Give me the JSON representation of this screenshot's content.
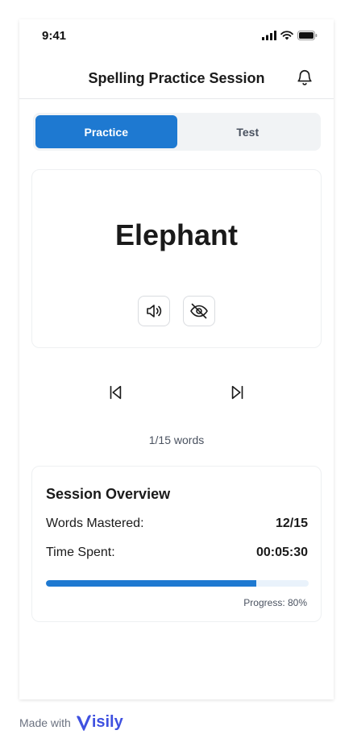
{
  "status_bar": {
    "time": "9:41"
  },
  "header": {
    "title": "Spelling Practice Session"
  },
  "tabs": [
    {
      "label": "Practice",
      "active": true
    },
    {
      "label": "Test",
      "active": false
    }
  ],
  "word_card": {
    "word": "Elephant",
    "audio_icon": "speaker-icon",
    "hide_icon": "eye-off-icon"
  },
  "navigation": {
    "previous_icon": "skip-previous-icon",
    "next_icon": "skip-next-icon",
    "counter": "1/15 words"
  },
  "overview": {
    "title": "Session Overview",
    "rows": [
      {
        "label": "Words Mastered:",
        "value": "12/15"
      },
      {
        "label": "Time Spent:",
        "value": "00:05:30"
      }
    ],
    "progress_label": "Progress: 80%",
    "progress_fraction": 0.8
  },
  "footer": {
    "made_with": "Made with",
    "brand": "isily"
  },
  "colors": {
    "accent": "#1e79d1",
    "progress_track": "#e9f2fb",
    "brand": "#3f51e0"
  }
}
